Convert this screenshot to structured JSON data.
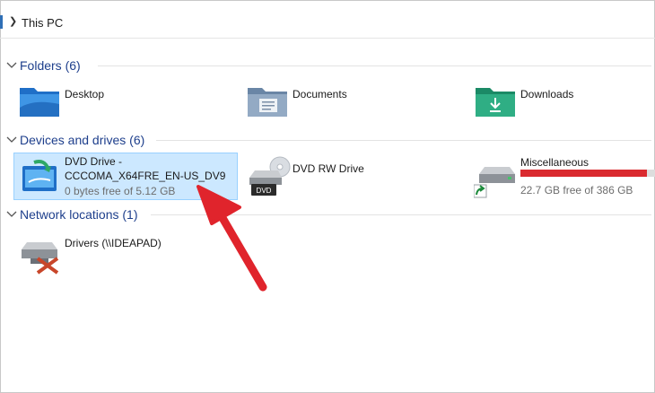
{
  "address_bar": {
    "breadcrumb": "This PC"
  },
  "groups": {
    "folders": {
      "title": "Folders (6)"
    },
    "devices": {
      "title": "Devices and drives (6)"
    },
    "network": {
      "title": "Network locations (1)"
    }
  },
  "folders": [
    {
      "label": "Desktop",
      "icon": "desktop-folder-icon"
    },
    {
      "label": "Documents",
      "icon": "documents-folder-icon"
    },
    {
      "label": "Downloads",
      "icon": "downloads-folder-icon"
    }
  ],
  "drives": [
    {
      "label_line1": "DVD Drive -",
      "label_line2": "CCCOMA_X64FRE_EN-US_DV9",
      "free": "0 bytes free of 5.12 GB",
      "icon": "dvd-installer-icon",
      "selected": true
    },
    {
      "label": "DVD RW Drive",
      "icon": "dvd-rw-drive-icon",
      "badge": "DVD"
    },
    {
      "label": "Miscellaneous",
      "free": "22.7 GB free of 386 GB",
      "used_fraction": 0.94,
      "icon": "network-drive-shortcut-icon"
    }
  ],
  "network": [
    {
      "label": "Drivers (\\\\IDEAPAD)",
      "icon": "disconnected-network-drive-icon"
    }
  ],
  "colors": {
    "accent": "#1e3f8c",
    "selection": "#cce8ff",
    "selection_border": "#99d1ff",
    "bar_full": "#da2a2f",
    "arrow": "#e0242c"
  }
}
